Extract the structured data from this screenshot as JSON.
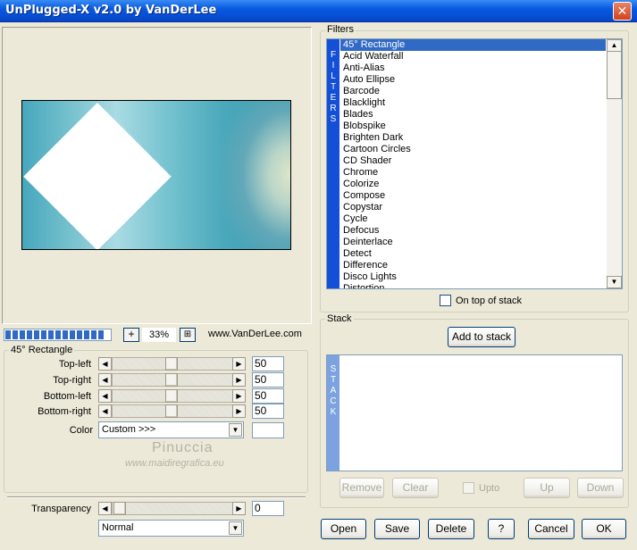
{
  "window": {
    "title": "UnPlugged-X v2.0 by VanDerLee",
    "close_label": "✕"
  },
  "zoom": {
    "plus_label": "+",
    "value": "33%",
    "fit_label": "⊞",
    "website": "www.VanDerLee.com",
    "progress_segments": 14
  },
  "params": {
    "group_label": "45° Rectangle",
    "sliders": [
      {
        "label": "Top-left",
        "value": "50"
      },
      {
        "label": "Top-right",
        "value": "50"
      },
      {
        "label": "Bottom-left",
        "value": "50"
      },
      {
        "label": "Bottom-right",
        "value": "50"
      }
    ],
    "color_label": "Color",
    "color_value": "Custom >>>",
    "transparency_label": "Transparency",
    "transparency_value": "0",
    "blend_value": "Normal"
  },
  "watermark": {
    "name": "Pinuccia",
    "url": "www.maidiregrafica.eu"
  },
  "filters": {
    "group_label": "Filters",
    "side_label": "FILTERS",
    "items": [
      "45° Rectangle",
      "Acid Waterfall",
      "Anti-Alias",
      "Auto Ellipse",
      "Barcode",
      "Blacklight",
      "Blades",
      "Blobspike",
      "Brighten Dark",
      "Cartoon Circles",
      "CD Shader",
      "Chrome",
      "Colorize",
      "Compose",
      "Copystar",
      "Cycle",
      "Defocus",
      "Deinterlace",
      "Detect",
      "Difference",
      "Disco Lights",
      "Distortion"
    ],
    "selected_index": 0,
    "on_top_label": "On top of stack"
  },
  "stack": {
    "group_label": "Stack",
    "side_label": "STACK",
    "add_label": "Add to stack",
    "remove_label": "Remove",
    "clear_label": "Clear",
    "upto_label": "Upto",
    "up_label": "Up",
    "down_label": "Down"
  },
  "footer": {
    "open_label": "Open",
    "save_label": "Save",
    "delete_label": "Delete",
    "help_label": "?",
    "cancel_label": "Cancel",
    "ok_label": "OK"
  }
}
